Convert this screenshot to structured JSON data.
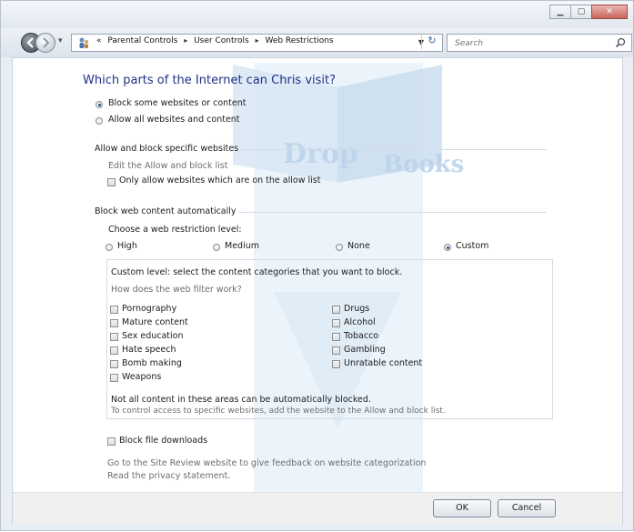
{
  "address": {
    "crumbs": [
      "«",
      "Parental Controls",
      "User Controls",
      "Web Restrictions"
    ],
    "sep": "▸"
  },
  "search": {
    "placeholder": "Search"
  },
  "main": {
    "question": "Which parts of the Internet can Chris visit?",
    "option_block": "Block some websites or content",
    "option_allow": "Allow all websites and content",
    "section_allow_block": "Allow and block specific websites",
    "edit_list_link": "Edit the Allow and block list",
    "only_allow_label": "Only allow websites which are on the allow list",
    "section_block_auto": "Block web content automatically",
    "choose_level": "Choose a web restriction level:",
    "levels": {
      "high": "High",
      "medium": "Medium",
      "none": "None",
      "custom": "Custom"
    },
    "custom_intro": "Custom level:  select the content categories that you want to block.",
    "filter_link": "How does the web filter work?",
    "categories_left": [
      "Pornography",
      "Mature content",
      "Sex education",
      "Hate speech",
      "Bomb making",
      "Weapons"
    ],
    "categories_right": [
      "Drugs",
      "Alcohol",
      "Tobacco",
      "Gambling",
      "Unratable content"
    ],
    "note": "Not all content in these areas can be automatically blocked.",
    "note_sub": "To control access to specific websites, add the website to the Allow and block list.",
    "block_downloads": "Block file downloads",
    "site_review_link": "Go to the Site Review website to give feedback on website categorization",
    "privacy_link": "Read the privacy statement."
  },
  "buttons": {
    "ok": "OK",
    "cancel": "Cancel"
  },
  "watermark": {
    "text": "Drop Books"
  },
  "colors": {
    "heading": "#1e3287",
    "link": "#2c5fa8",
    "watermark": "#c8dcef"
  }
}
